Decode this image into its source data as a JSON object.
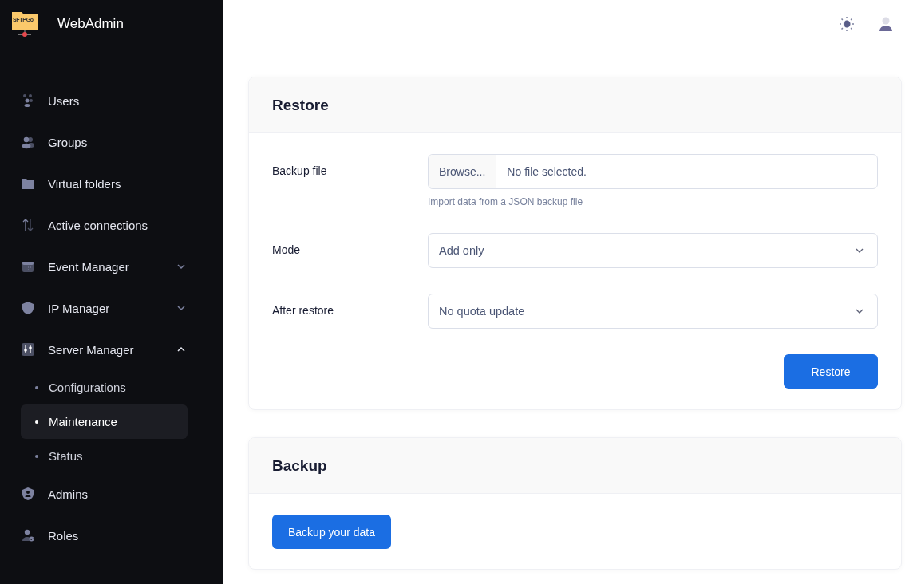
{
  "sidebar": {
    "logo_text": "SFTPGo",
    "title": "WebAdmin",
    "items": [
      {
        "label": "Users",
        "selected": false
      },
      {
        "label": "Groups",
        "selected": false
      },
      {
        "label": "Virtual folders",
        "selected": false
      },
      {
        "label": "Active connections",
        "selected": false
      },
      {
        "label": "Event Manager",
        "selected": false,
        "expanded": false
      },
      {
        "label": "IP Manager",
        "selected": false,
        "expanded": false
      },
      {
        "label": "Server Manager",
        "selected": false,
        "expanded": true,
        "children": [
          {
            "label": "Configurations",
            "selected": false
          },
          {
            "label": "Maintenance",
            "selected": true
          },
          {
            "label": "Status",
            "selected": false
          }
        ]
      },
      {
        "label": "Admins",
        "selected": false
      },
      {
        "label": "Roles",
        "selected": false
      }
    ]
  },
  "restore": {
    "title": "Restore",
    "backup_file": {
      "label": "Backup file",
      "button": "Browse...",
      "value": "No file selected.",
      "hint": "Import data from a JSON backup file"
    },
    "mode": {
      "label": "Mode",
      "value": "Add only"
    },
    "after_restore": {
      "label": "After restore",
      "value": "No quota update"
    },
    "button": "Restore"
  },
  "backup": {
    "title": "Backup",
    "button": "Backup your data"
  }
}
